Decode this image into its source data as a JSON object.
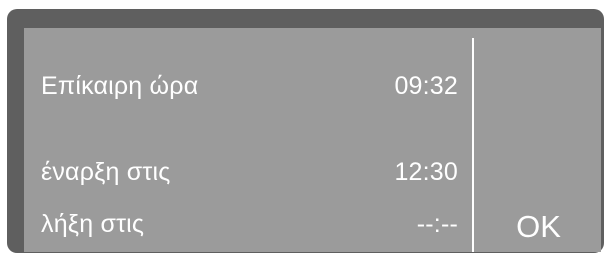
{
  "display": {
    "rows": [
      {
        "label": "Επίκαιρη ώρα",
        "value": "09:32"
      },
      {
        "label": "έναρξη στις",
        "value": "12:30"
      },
      {
        "label": "λήξη στις",
        "value": "--:--"
      }
    ],
    "ok_label": "OK"
  },
  "colors": {
    "frame": "#5f5f5f",
    "screen": "#9b9b9b",
    "text": "#ffffff"
  }
}
